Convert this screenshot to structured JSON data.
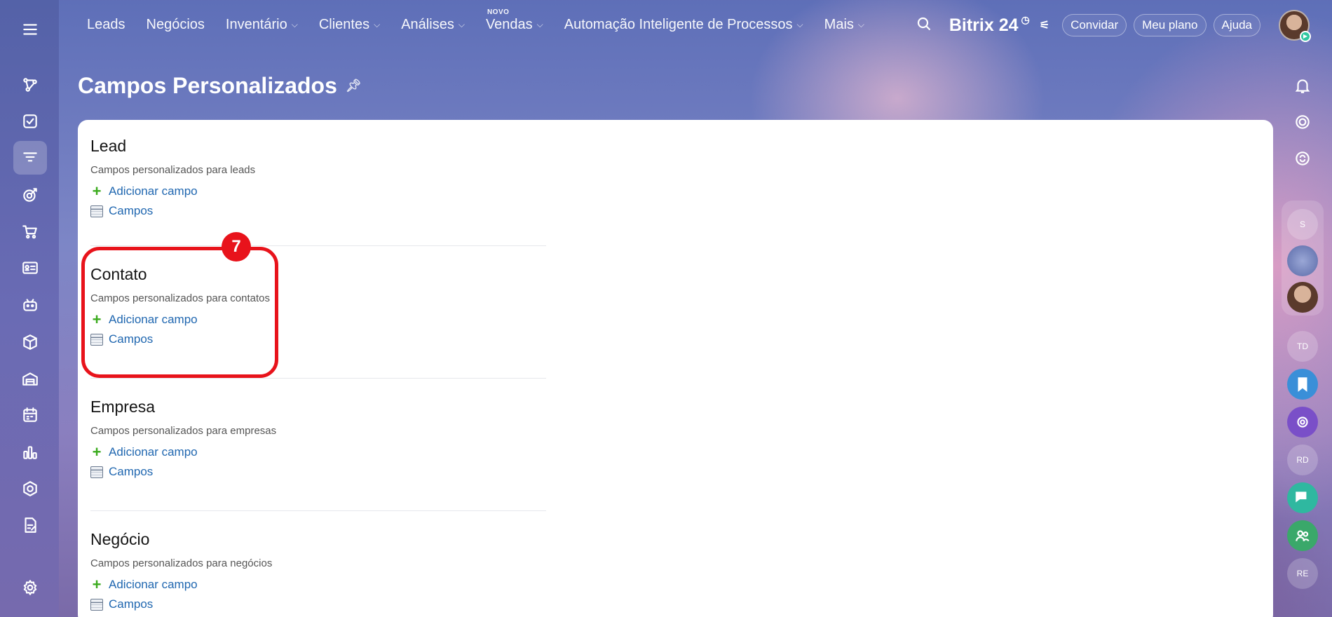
{
  "nav": {
    "items": [
      {
        "label": "Leads",
        "dropdown": false
      },
      {
        "label": "Negócios",
        "dropdown": false
      },
      {
        "label": "Inventário",
        "dropdown": true
      },
      {
        "label": "Clientes",
        "dropdown": true
      },
      {
        "label": "Análises",
        "dropdown": true
      },
      {
        "label": "Vendas",
        "dropdown": true,
        "badge": "NOVO"
      },
      {
        "label": "Automação Inteligente de Processos",
        "dropdown": true
      },
      {
        "label": "Mais",
        "dropdown": true
      }
    ]
  },
  "header": {
    "brand": "Bitrix 24",
    "invite_label": "Convidar",
    "plan_label": "Meu plano",
    "help_label": "Ajuda"
  },
  "page": {
    "title": "Campos Personalizados"
  },
  "sections": [
    {
      "title": "Lead",
      "description": "Campos personalizados para leads",
      "add_label": "Adicionar campo",
      "fields_label": "Campos"
    },
    {
      "title": "Contato",
      "description": "Campos personalizados para contatos",
      "add_label": "Adicionar campo",
      "fields_label": "Campos"
    },
    {
      "title": "Empresa",
      "description": "Campos personalizados para empresas",
      "add_label": "Adicionar campo",
      "fields_label": "Campos"
    },
    {
      "title": "Negócio",
      "description": "Campos personalizados para negócios",
      "add_label": "Adicionar campo",
      "fields_label": "Campos"
    }
  ],
  "callout": {
    "number": "7",
    "color": "#e8131b"
  },
  "right_rail": {
    "avatars": [
      "S",
      "TD",
      "RD",
      "RE"
    ]
  },
  "colors": {
    "link": "#2067b0",
    "plus": "#3bab1e",
    "accent_badge": "#e8131b"
  }
}
